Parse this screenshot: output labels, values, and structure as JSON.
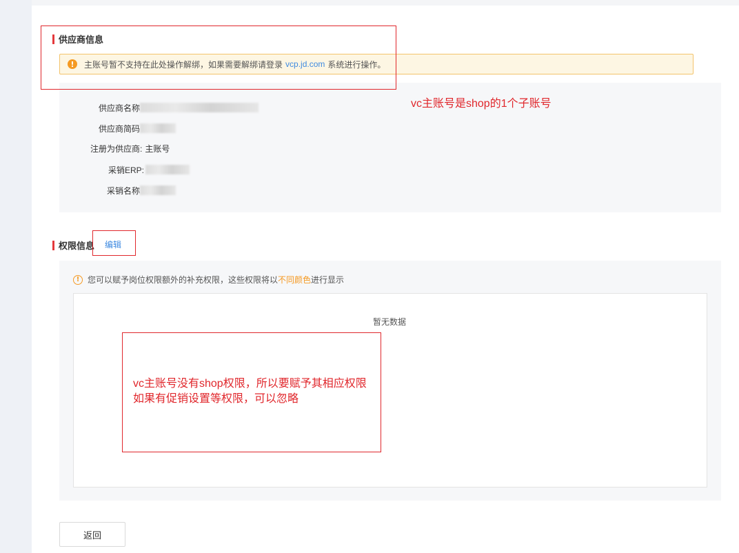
{
  "supplier_section": {
    "title": "供应商信息",
    "notice_prefix": "主账号暂不支持在此处操作解绑，如果需要解绑请登录",
    "notice_link": "vcp.jd.com",
    "notice_suffix": "系统进行操作。",
    "fields": [
      {
        "label": "供应商名称",
        "value": ""
      },
      {
        "label": "供应商简码",
        "value": ""
      },
      {
        "label": "注册为供应商:",
        "value": "主账号"
      },
      {
        "label": "采销ERP:",
        "value": ""
      },
      {
        "label": "采销名称",
        "value": ""
      }
    ]
  },
  "permission_section": {
    "title": "权限信息",
    "edit_label": "编辑",
    "hint_prefix": "您可以赋予岗位权限额外的补充权限，这些权限将以",
    "hint_highlight": "不同颜色",
    "hint_suffix": "进行显示",
    "empty_text": "暂无数据"
  },
  "back_button": {
    "label": "返回"
  },
  "annotations": {
    "note1": "vc主账号是shop的1个子账号",
    "note2_line1": "vc主账号没有shop权限，所以要赋予其相应权限",
    "note2_line2": "如果有促销设置等权限，可以忽略"
  },
  "colors": {
    "accent_red": "#e4393c",
    "link_blue": "#3f8ae0",
    "warn_orange": "#f59a23"
  }
}
